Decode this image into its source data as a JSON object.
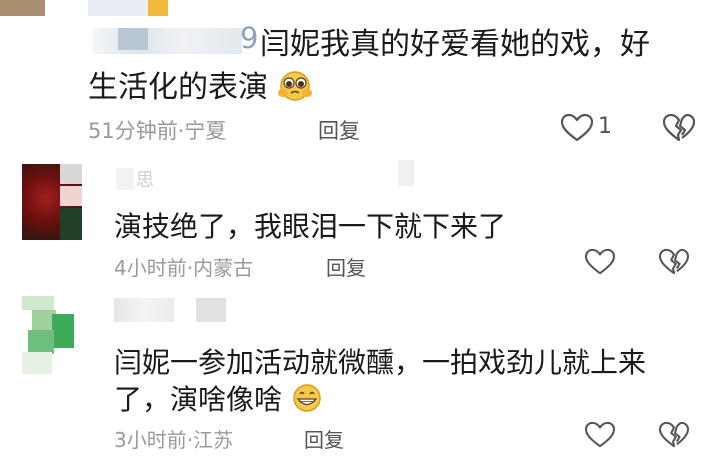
{
  "comments": [
    {
      "username": "",
      "username_tail": "9",
      "text_line1": "闫妮我真的好爱看她的戏，好",
      "text_line2": "生活化的表演",
      "emoji": "pleading-face-icon",
      "time": "51分钟前",
      "location": "宁夏",
      "reply_label": "回复",
      "like_count": "1"
    },
    {
      "username": "思",
      "text_line1": "演技绝了，我眼泪一下就下来了",
      "time": "4小时前",
      "location": "内蒙古",
      "reply_label": "回复",
      "like_count": ""
    },
    {
      "username": "",
      "text_line1": "闫妮一参加活动就微醺，一拍戏劲儿就上来",
      "text_line2": "了，演啥像啥",
      "emoji": "grinning-face-icon",
      "time": "3小时前",
      "location": "江苏",
      "reply_label": "回复",
      "like_count": ""
    }
  ],
  "meta_separator": "·",
  "colors": {
    "text": "#1a1a1a",
    "meta": "#9a9a9a",
    "icon": "#555555"
  }
}
